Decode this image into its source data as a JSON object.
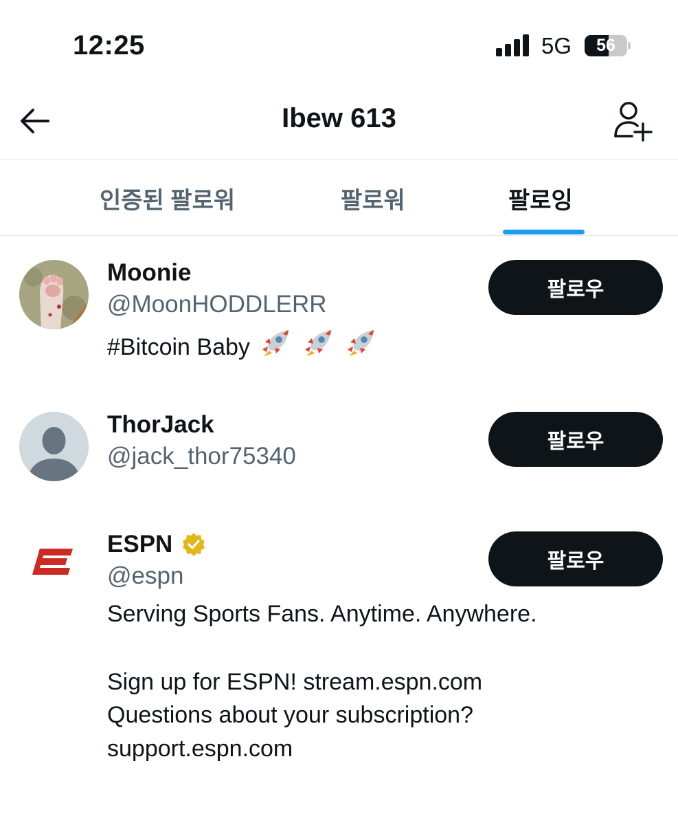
{
  "status_bar": {
    "time": "12:25",
    "network": "5G",
    "battery": "56",
    "battery_level": 0.56
  },
  "header": {
    "title": "Ibew 613",
    "back_icon": "arrow-left-icon",
    "add_icon": "add-user-icon"
  },
  "tabs": [
    {
      "label": "인증된 팔로워",
      "active": false
    },
    {
      "label": "팔로워",
      "active": false
    },
    {
      "label": "팔로잉",
      "active": true
    }
  ],
  "users": [
    {
      "name": "Moonie",
      "handle": "@MoonHODDLERR",
      "bio": "#Bitcoin Baby",
      "bio_emoji": [
        "rocket",
        "rocket",
        "rocket"
      ],
      "follow_label": "팔로우",
      "avatar": "cat-paw-photo"
    },
    {
      "name": "ThorJack",
      "handle": "@jack_thor75340",
      "follow_label": "팔로우",
      "avatar": "default-avatar"
    },
    {
      "name": "ESPN",
      "handle": "@espn",
      "verified": true,
      "bio_lines": [
        "Serving Sports Fans. Anytime. Anywhere.",
        "",
        "Sign up for ESPN! stream.espn.com",
        "Questions about your subscription?",
        "support.espn.com"
      ],
      "follow_label": "팔로우",
      "avatar": "espn-logo"
    }
  ],
  "colors": {
    "accent": "#1d9bf0",
    "text": "#0f1419",
    "secondary": "#536471",
    "button": "#0f1419",
    "espn_red": "#cc2a24",
    "verified_gold": "#e2b719"
  }
}
